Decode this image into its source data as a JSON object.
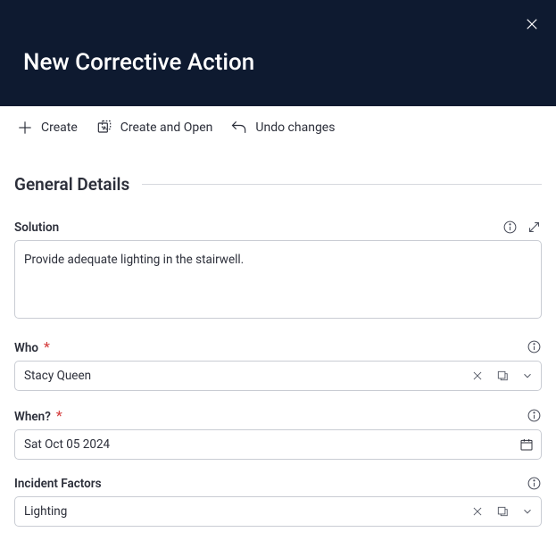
{
  "header": {
    "title": "New Corrective Action"
  },
  "toolbar": {
    "create": "Create",
    "create_open": "Create and Open",
    "undo": "Undo changes"
  },
  "section": {
    "general": "General Details"
  },
  "fields": {
    "solution": {
      "label": "Solution",
      "value": "Provide adequate lighting in the stairwell."
    },
    "who": {
      "label": "Who",
      "required": "*",
      "value": "Stacy Queen"
    },
    "when": {
      "label": "When?",
      "required": "*",
      "value": "Sat Oct 05 2024"
    },
    "incident_factors": {
      "label": "Incident Factors",
      "value": "Lighting"
    }
  }
}
